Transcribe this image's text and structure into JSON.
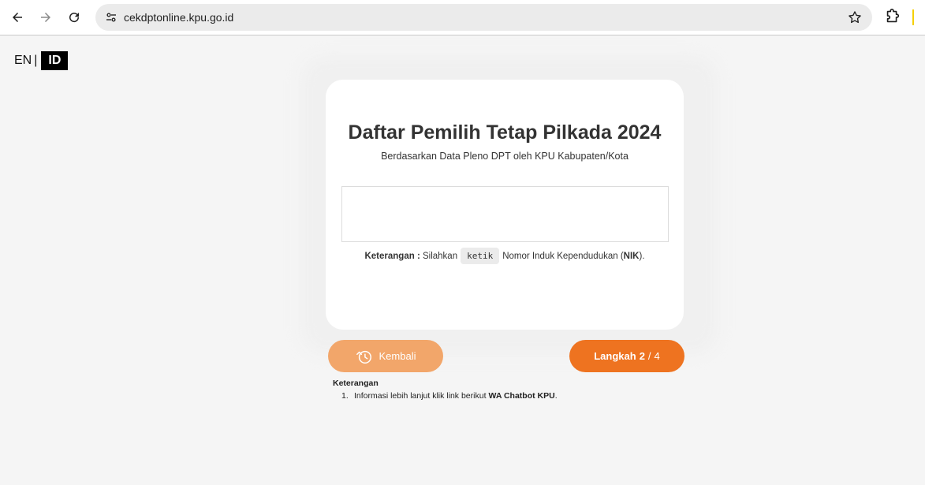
{
  "browser": {
    "url": "cekdptonline.kpu.go.id",
    "icons": [
      "back-arrow-icon",
      "forward-arrow-icon",
      "reload-icon",
      "site-info-icon",
      "bookmark-star-icon",
      "extensions-puzzle-icon"
    ]
  },
  "language": {
    "en": "EN",
    "separator": "|",
    "id": "ID"
  },
  "card": {
    "title": "Daftar Pemilih Tetap Pilkada 2024",
    "subtitle": "Berdasarkan Data Pleno DPT oleh KPU Kabupaten/Kota",
    "input_value": "",
    "note": {
      "label": "Keterangan :",
      "pre": "Silahkan",
      "keyword": "ketik",
      "post": "Nomor Induk Kependudukan (",
      "abbr": "NIK",
      "end": ")."
    }
  },
  "buttons": {
    "back_label": "Kembali",
    "next_prefix": "Langkah",
    "next_current": "2",
    "next_sep": "/",
    "next_total": "4"
  },
  "info": {
    "title": "Keterangan",
    "items": [
      {
        "num": "1.",
        "text": "Informasi lebih lanjut klik link berikut",
        "link": "WA Chatbot KPU",
        "end": "."
      }
    ]
  },
  "colors": {
    "accent": "#ee7320",
    "accent_light": "#f2a66a",
    "background": "#f5f5f5"
  }
}
